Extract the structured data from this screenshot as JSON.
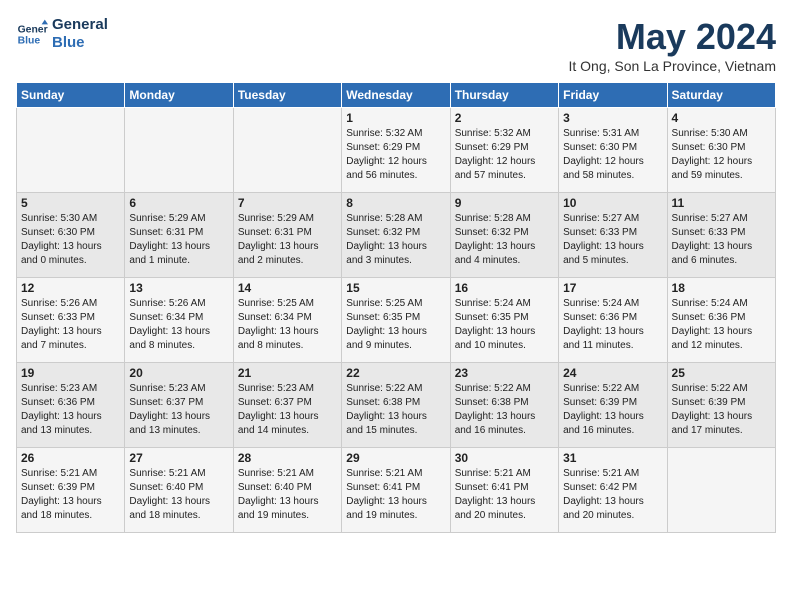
{
  "logo": {
    "line1": "General",
    "line2": "Blue"
  },
  "title": "May 2024",
  "subtitle": "It Ong, Son La Province, Vietnam",
  "days_header": [
    "Sunday",
    "Monday",
    "Tuesday",
    "Wednesday",
    "Thursday",
    "Friday",
    "Saturday"
  ],
  "weeks": [
    [
      {
        "num": "",
        "info": ""
      },
      {
        "num": "",
        "info": ""
      },
      {
        "num": "",
        "info": ""
      },
      {
        "num": "1",
        "info": "Sunrise: 5:32 AM\nSunset: 6:29 PM\nDaylight: 12 hours\nand 56 minutes."
      },
      {
        "num": "2",
        "info": "Sunrise: 5:32 AM\nSunset: 6:29 PM\nDaylight: 12 hours\nand 57 minutes."
      },
      {
        "num": "3",
        "info": "Sunrise: 5:31 AM\nSunset: 6:30 PM\nDaylight: 12 hours\nand 58 minutes."
      },
      {
        "num": "4",
        "info": "Sunrise: 5:30 AM\nSunset: 6:30 PM\nDaylight: 12 hours\nand 59 minutes."
      }
    ],
    [
      {
        "num": "5",
        "info": "Sunrise: 5:30 AM\nSunset: 6:30 PM\nDaylight: 13 hours\nand 0 minutes."
      },
      {
        "num": "6",
        "info": "Sunrise: 5:29 AM\nSunset: 6:31 PM\nDaylight: 13 hours\nand 1 minute."
      },
      {
        "num": "7",
        "info": "Sunrise: 5:29 AM\nSunset: 6:31 PM\nDaylight: 13 hours\nand 2 minutes."
      },
      {
        "num": "8",
        "info": "Sunrise: 5:28 AM\nSunset: 6:32 PM\nDaylight: 13 hours\nand 3 minutes."
      },
      {
        "num": "9",
        "info": "Sunrise: 5:28 AM\nSunset: 6:32 PM\nDaylight: 13 hours\nand 4 minutes."
      },
      {
        "num": "10",
        "info": "Sunrise: 5:27 AM\nSunset: 6:33 PM\nDaylight: 13 hours\nand 5 minutes."
      },
      {
        "num": "11",
        "info": "Sunrise: 5:27 AM\nSunset: 6:33 PM\nDaylight: 13 hours\nand 6 minutes."
      }
    ],
    [
      {
        "num": "12",
        "info": "Sunrise: 5:26 AM\nSunset: 6:33 PM\nDaylight: 13 hours\nand 7 minutes."
      },
      {
        "num": "13",
        "info": "Sunrise: 5:26 AM\nSunset: 6:34 PM\nDaylight: 13 hours\nand 8 minutes."
      },
      {
        "num": "14",
        "info": "Sunrise: 5:25 AM\nSunset: 6:34 PM\nDaylight: 13 hours\nand 8 minutes."
      },
      {
        "num": "15",
        "info": "Sunrise: 5:25 AM\nSunset: 6:35 PM\nDaylight: 13 hours\nand 9 minutes."
      },
      {
        "num": "16",
        "info": "Sunrise: 5:24 AM\nSunset: 6:35 PM\nDaylight: 13 hours\nand 10 minutes."
      },
      {
        "num": "17",
        "info": "Sunrise: 5:24 AM\nSunset: 6:36 PM\nDaylight: 13 hours\nand 11 minutes."
      },
      {
        "num": "18",
        "info": "Sunrise: 5:24 AM\nSunset: 6:36 PM\nDaylight: 13 hours\nand 12 minutes."
      }
    ],
    [
      {
        "num": "19",
        "info": "Sunrise: 5:23 AM\nSunset: 6:36 PM\nDaylight: 13 hours\nand 13 minutes."
      },
      {
        "num": "20",
        "info": "Sunrise: 5:23 AM\nSunset: 6:37 PM\nDaylight: 13 hours\nand 13 minutes."
      },
      {
        "num": "21",
        "info": "Sunrise: 5:23 AM\nSunset: 6:37 PM\nDaylight: 13 hours\nand 14 minutes."
      },
      {
        "num": "22",
        "info": "Sunrise: 5:22 AM\nSunset: 6:38 PM\nDaylight: 13 hours\nand 15 minutes."
      },
      {
        "num": "23",
        "info": "Sunrise: 5:22 AM\nSunset: 6:38 PM\nDaylight: 13 hours\nand 16 minutes."
      },
      {
        "num": "24",
        "info": "Sunrise: 5:22 AM\nSunset: 6:39 PM\nDaylight: 13 hours\nand 16 minutes."
      },
      {
        "num": "25",
        "info": "Sunrise: 5:22 AM\nSunset: 6:39 PM\nDaylight: 13 hours\nand 17 minutes."
      }
    ],
    [
      {
        "num": "26",
        "info": "Sunrise: 5:21 AM\nSunset: 6:39 PM\nDaylight: 13 hours\nand 18 minutes."
      },
      {
        "num": "27",
        "info": "Sunrise: 5:21 AM\nSunset: 6:40 PM\nDaylight: 13 hours\nand 18 minutes."
      },
      {
        "num": "28",
        "info": "Sunrise: 5:21 AM\nSunset: 6:40 PM\nDaylight: 13 hours\nand 19 minutes."
      },
      {
        "num": "29",
        "info": "Sunrise: 5:21 AM\nSunset: 6:41 PM\nDaylight: 13 hours\nand 19 minutes."
      },
      {
        "num": "30",
        "info": "Sunrise: 5:21 AM\nSunset: 6:41 PM\nDaylight: 13 hours\nand 20 minutes."
      },
      {
        "num": "31",
        "info": "Sunrise: 5:21 AM\nSunset: 6:42 PM\nDaylight: 13 hours\nand 20 minutes."
      },
      {
        "num": "",
        "info": ""
      }
    ]
  ]
}
